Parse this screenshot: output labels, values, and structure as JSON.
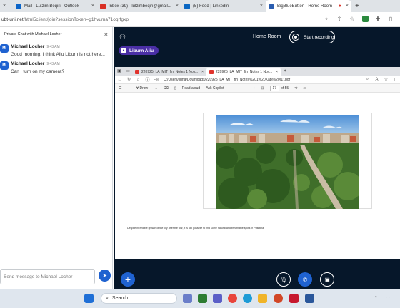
{
  "browser": {
    "tabs": [
      {
        "label": "Mail - Lulzim Beqiri - Outlook",
        "color": "#0a64c8"
      },
      {
        "label": "Inbox (39) - lulzimbeqiri@gmail...",
        "color": "#d93025"
      },
      {
        "label": "(5) Feed | LinkedIn",
        "color": "#0a66c2"
      },
      {
        "label": "BigBlueButton - Home Room",
        "color": "#2a5db0"
      }
    ],
    "new_tab": "+",
    "url_prefix": "ubt-uni.net",
    "url_rest": "/html5client/join?sessionToken=g1hvuma71oqrfgxp"
  },
  "chat": {
    "title": "Private Chat with Michael Locher",
    "messages": [
      {
        "initials": "Mi",
        "name": "Michael Locher",
        "time": "9:43 AM",
        "text": "Good morning, I think Aliu Liburn is not here..."
      },
      {
        "initials": "Mi",
        "name": "Michael Locher",
        "time": "9:43 AM",
        "text": "Can I turn on my camera?"
      }
    ],
    "input_placeholder": "Send message to Michael Locher"
  },
  "meeting": {
    "room_title": "Home Room",
    "record_label": "Start recording",
    "speaker_name": "Liburn Aliu"
  },
  "shared_screen": {
    "tabs": [
      {
        "label": "220925_LA_MIT_fin_Notes 1 Nov..."
      },
      {
        "label": "220925_LA_MIT_fin_Notes 1 Nov..."
      }
    ],
    "file_label": "File",
    "path": "C:/Users/lirina/Downloads/220925_LA_MIT_fin_Notes%201%20Kapi%20(1).pdf",
    "toolbar": {
      "draw": "Draw",
      "read_aloud": "Read aloud",
      "ask_copilot": "Ask Copilot",
      "zoom_minus": "−",
      "zoom_plus": "+",
      "page_current": "17",
      "page_total": "of 55"
    },
    "caption": "Despite incredible growth of the city after the war, it is still possible to find some natural and breathable spots in Prishtina."
  },
  "taskbar": {
    "search_label": "Search"
  }
}
